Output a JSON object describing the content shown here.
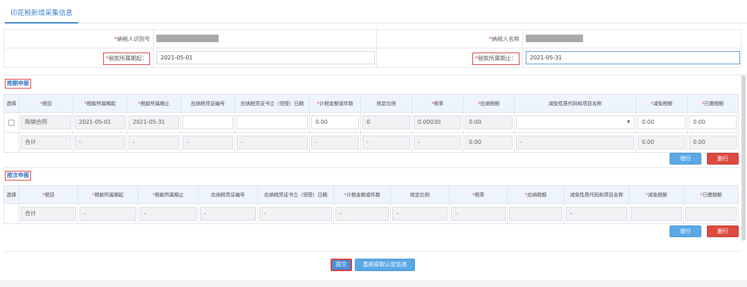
{
  "tab": {
    "title": "印花税新增采集信息"
  },
  "form": {
    "taxpayer_id_label": "纳税人识别号",
    "taxpayer_name_label": "纳税人名称",
    "period_start_label": "税款所属期起：",
    "period_start_value": "2021-05-01",
    "period_end_label": "税款所属期止：",
    "period_end_value": "2021-05-31",
    "required_mark": "*"
  },
  "periodic": {
    "title": "按期申报",
    "headers": [
      "选择",
      "税目",
      "税款所属期起",
      "税款所属期止",
      "应纳税凭证编号",
      "应纳税凭证书立（领受）日期",
      "计税金额或件数",
      "核定比例",
      "税率",
      "应纳税额",
      "减免性质代码和项目名称",
      "减免税额",
      "已缴税额"
    ],
    "row": {
      "item": "购销合同",
      "start": "2021-05-01",
      "end": "2021-05-31",
      "voucher_no": "",
      "voucher_date": "",
      "amount": "0.00",
      "ratio": "0",
      "rate": "0.00030",
      "tax": "0.00",
      "relief_code": "",
      "relief": "0.00",
      "paid": "0.00"
    },
    "total": {
      "label": "合计",
      "start": "-",
      "end": "-",
      "voucher_no": "-",
      "voucher_date": "-",
      "amount": "-",
      "ratio": "-",
      "rate": "-",
      "tax": "0.00",
      "relief_code": "-",
      "relief": "0.00",
      "paid": "0.00"
    },
    "add_label": "增行",
    "delete_label": "删行"
  },
  "per_time": {
    "title": "按次申报",
    "headers": [
      "选择",
      "税目",
      "税款所属期起",
      "税款所属期止",
      "应纳税凭证编号",
      "应纳税凭证书立（领受）日期",
      "计税金额或件数",
      "核定比例",
      "税率",
      "应纳税额",
      "减免性质代码和项目名称",
      "减免税额",
      "已缴税额"
    ],
    "total": {
      "label": "合计",
      "start": "-",
      "end": "-",
      "voucher_no": "-",
      "voucher_date": "-",
      "amount": "-",
      "ratio": "-",
      "rate": "-",
      "tax": "",
      "relief_code": "-",
      "relief": "",
      "paid": ""
    },
    "add_label": "增行",
    "delete_label": "删行"
  },
  "footer": {
    "submit_label": "提交",
    "refetch_label": "重新提取认定信息"
  },
  "colors": {
    "accent": "#3a7fc7",
    "header_bg": "#eef4fb",
    "add_button": "#5aa8e6",
    "delete_button": "#dc4a40",
    "highlight": "#d83a3a"
  }
}
